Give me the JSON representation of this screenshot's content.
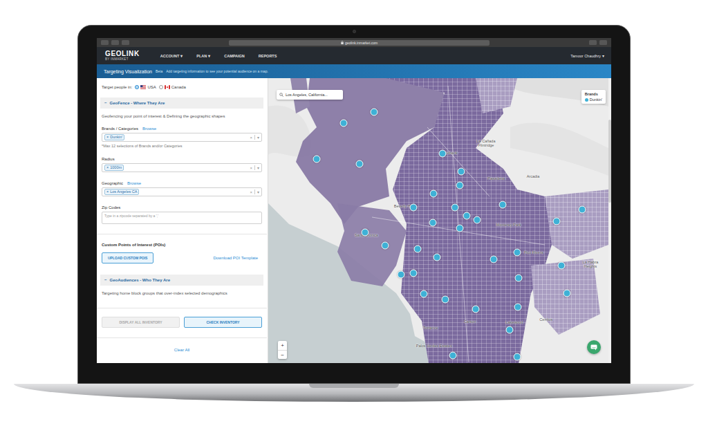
{
  "browser": {
    "url": "geolink.inmarket.com"
  },
  "nav": {
    "logo": "GEOLINK",
    "logo_sub": "BY INMARKET",
    "items": [
      {
        "label": "ACCOUNT",
        "caret": "▾"
      },
      {
        "label": "PLAN",
        "caret": "▾"
      },
      {
        "label": "CAMPAIGN"
      },
      {
        "label": "REPORTS"
      }
    ],
    "user": "Tamoor Chaudhry",
    "user_caret": "▾"
  },
  "banner": {
    "title": "Targeting Visualization",
    "badge": "Beta",
    "text": "Add targeting information to see your potential audience on a map."
  },
  "panel": {
    "target": {
      "label": "Target people in:",
      "options": [
        {
          "label": "USA",
          "selected": true
        },
        {
          "label": "Canada",
          "selected": false
        }
      ]
    },
    "geofence": {
      "toggle": "−",
      "title": "GeoFence - Where They Are",
      "description": "Geofencing your point of interest & Defining the geographic shapes",
      "fields": [
        {
          "label": "Brands / Categories",
          "link": "Browse",
          "tags": [
            {
              "remove": "×",
              "label": "Dunkin'"
            }
          ],
          "clear": "×",
          "caret": "▾",
          "hint": "*Max 12 selections of Brands and/or Categories"
        },
        {
          "label": "Radius",
          "tags": [
            {
              "remove": "×",
              "label": "1000m"
            }
          ],
          "clear": "×",
          "caret": "▾"
        },
        {
          "label": "Geographic",
          "link": "Browse",
          "tags": [
            {
              "remove": "×",
              "label": "Los Angeles CA"
            }
          ],
          "clear": "×",
          "caret": "▾"
        }
      ],
      "zip": {
        "label": "Zip Codes",
        "placeholder": "Type in a zipcode separated by a ','"
      }
    },
    "custom_pois": {
      "title": "Custom Points of Interest (POIs)",
      "upload": "UPLOAD CUSTOM POIS",
      "template": "Download POI Template"
    },
    "geoaudiences": {
      "toggle": "−",
      "title": "GeoAudiences - Who They Are",
      "description": "Targeting home block groups that over-index selected demographics"
    },
    "actions": [
      {
        "label": "DISPLAY ALL INVENTORY",
        "disabled": true
      },
      {
        "label": "CHECK INVENTORY",
        "disabled": false
      }
    ],
    "clear_all": "Clear All"
  },
  "map": {
    "search": {
      "value": "Los Angeles, California..."
    },
    "legend": {
      "title": "Brands",
      "items": [
        {
          "label": "Dunkin'",
          "color": "#3fb1d6"
        }
      ]
    },
    "places": [
      "La Cañada Flintridge",
      "Burbank",
      "Pasadena",
      "Arcadia",
      "Beverly Hills",
      "Monterey Park",
      "Santa Monica",
      "Pico Rivera",
      "La Habra Heights",
      "Lakewood",
      "Cerritos",
      "Torrance",
      "Carson",
      "Palos Verdes Estates"
    ],
    "zoom": [
      "+",
      "−"
    ]
  }
}
